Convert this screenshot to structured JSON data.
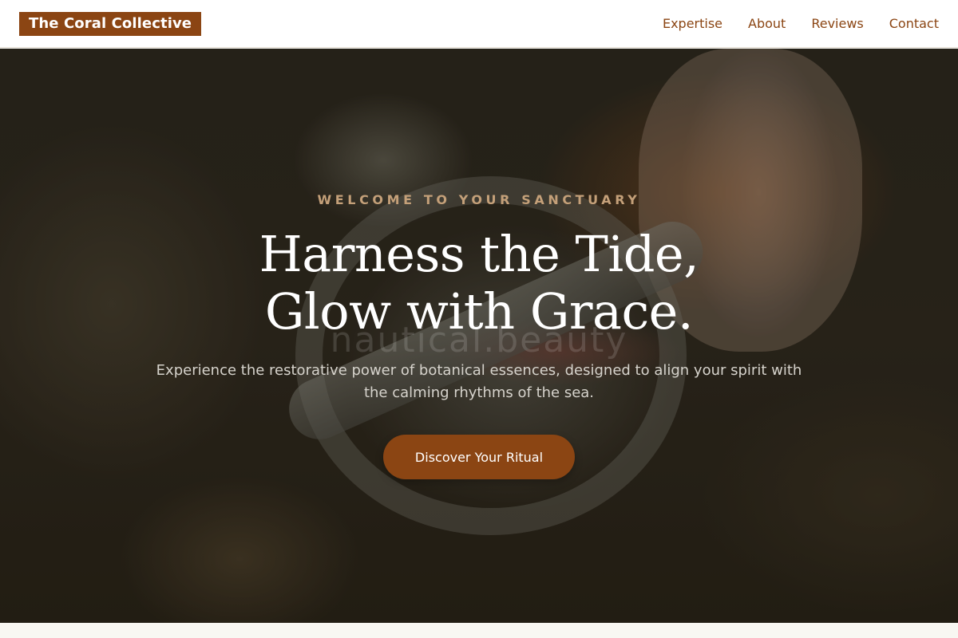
{
  "header": {
    "brand": "The Coral Collective",
    "nav": [
      "Expertise",
      "About",
      "Reviews",
      "Contact"
    ]
  },
  "hero": {
    "eyebrow": "WELCOME TO YOUR SANCTUARY",
    "headline_line1": "Harness the Tide,",
    "headline_line2": "Glow with Grace.",
    "watermark": "nautical.beauty",
    "subtext": "Experience the restorative power of botanical essences, designed to align your spirit with the calming rhythms of the sea.",
    "cta_label": "Discover Your Ritual"
  },
  "colors": {
    "brand": "#8b4513",
    "eyebrow": "#c4a079",
    "hero_text": "#ffffff",
    "page_background": "#f8f7f2"
  }
}
